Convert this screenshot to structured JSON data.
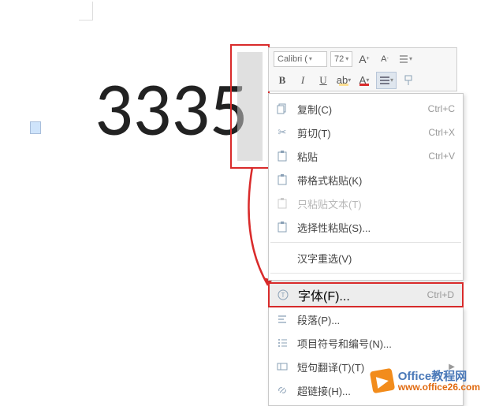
{
  "document": {
    "big_text": "3335"
  },
  "mini_toolbar": {
    "font_name": "Calibri (",
    "font_size": "72",
    "grow": "A",
    "shrink": "A",
    "bold": "B",
    "italic": "I",
    "underline": "U",
    "highlight": "ab",
    "fontcolor": "A"
  },
  "context_menu": {
    "copy": {
      "label": "复制(C)",
      "shortcut": "Ctrl+C"
    },
    "cut": {
      "label": "剪切(T)",
      "shortcut": "Ctrl+X"
    },
    "paste": {
      "label": "粘贴",
      "shortcut": "Ctrl+V"
    },
    "paste_format": {
      "label": "带格式粘贴(K)"
    },
    "paste_text": {
      "label": "只粘贴文本(T)"
    },
    "paste_special": {
      "label": "选择性粘贴(S)..."
    },
    "reselect": {
      "label": "汉字重选(V)"
    },
    "font": {
      "label": "字体(F)...",
      "shortcut": "Ctrl+D"
    },
    "paragraph": {
      "label": "段落(P)..."
    },
    "bullets": {
      "label": "项目符号和编号(N)..."
    },
    "translate": {
      "label": "短句翻译(T)(T)"
    },
    "hyperlink": {
      "label": "超链接(H)..."
    }
  },
  "watermark": {
    "brand1": "Office",
    "brand2": "教程网",
    "url": "www.office26.com"
  }
}
